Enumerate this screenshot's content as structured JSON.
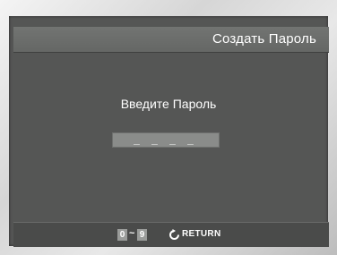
{
  "header": {
    "title": "Создать Пароль"
  },
  "main": {
    "prompt": "Введите Пароль",
    "password_mask": "_ _ _ _"
  },
  "footer": {
    "range_start": "0",
    "range_separator": "~",
    "range_end": "9",
    "return_label": "RETURN",
    "return_icon": "return-icon"
  }
}
